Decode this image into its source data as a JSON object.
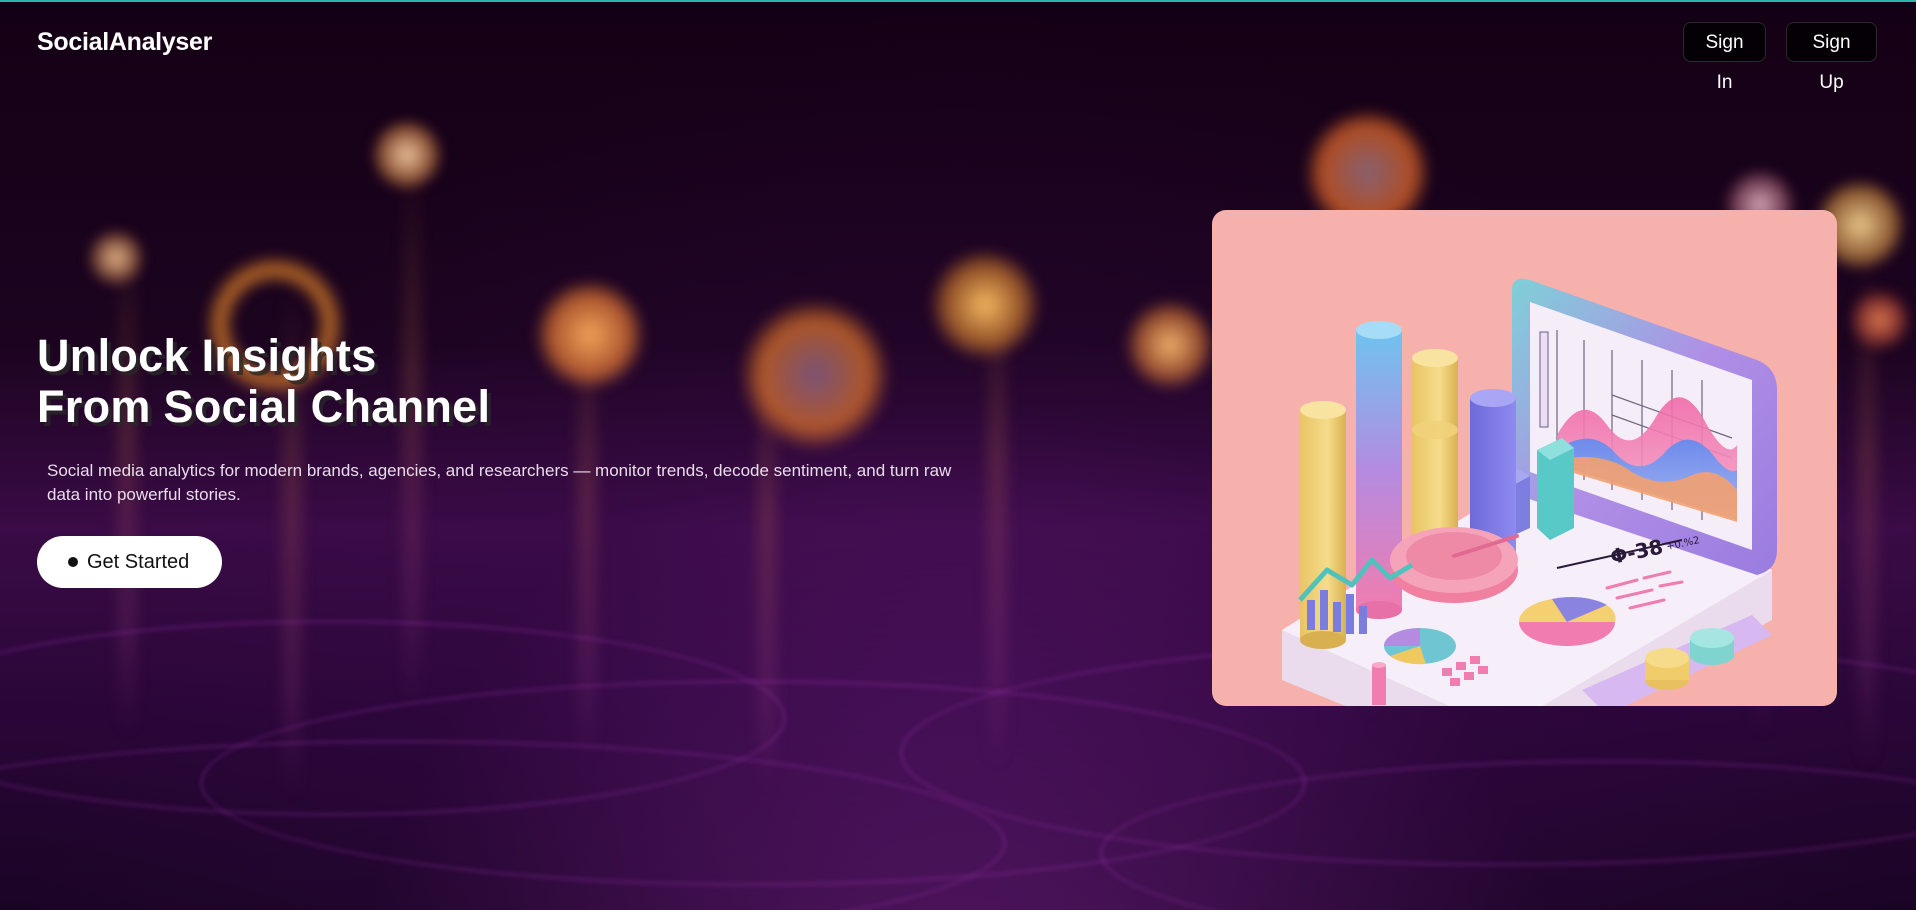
{
  "nav": {
    "brand": "SocialAnalyser",
    "sign_in_label": "Sign In",
    "sign_up_label": "Sign Up"
  },
  "hero": {
    "title_line1": "Unlock Insights",
    "title_line2": "From Social Channel",
    "subtitle": "Social media analytics for modern brands, agencies, and researchers — monitor trends, decode sentiment, and turn raw data into powerful stories.",
    "cta_label": "Get Started"
  },
  "illustration": {
    "readout": "Φ-38",
    "readout_small": "+0.%2"
  },
  "colors": {
    "accent_line": "#2bb3a8",
    "illustration_bg": "#f7b1ad",
    "cta_bg": "#ffffff",
    "nav_button_bg": "#050005"
  },
  "icons": {
    "cta": "dot-icon"
  }
}
